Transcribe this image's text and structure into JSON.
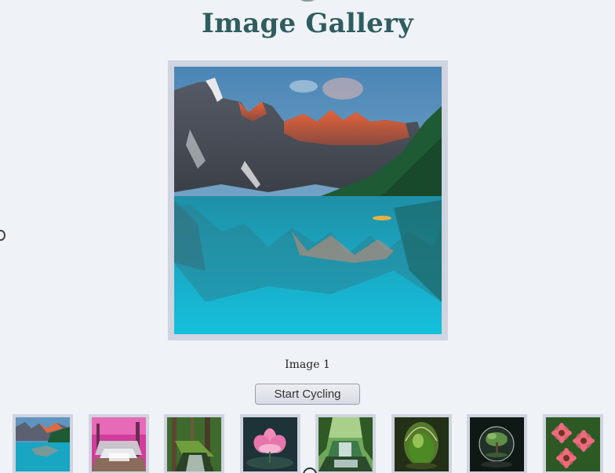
{
  "page": {
    "title": "Image Gallery"
  },
  "viewer": {
    "caption": "Image 1",
    "button_label": "Start Cycling"
  },
  "thumbnails": [
    {
      "subject": "mountain-lake"
    },
    {
      "subject": "pink-waterfall"
    },
    {
      "subject": "forest-stream"
    },
    {
      "subject": "lotus-flower"
    },
    {
      "subject": "jungle-waterfall"
    },
    {
      "subject": "moss-in-glass-egg"
    },
    {
      "subject": "bonsai-in-glass-orb"
    },
    {
      "subject": "pink-daisies"
    }
  ],
  "colors": {
    "background": "#eff2f7",
    "title": "#2f5d5f",
    "frame": "#cfd4df"
  }
}
